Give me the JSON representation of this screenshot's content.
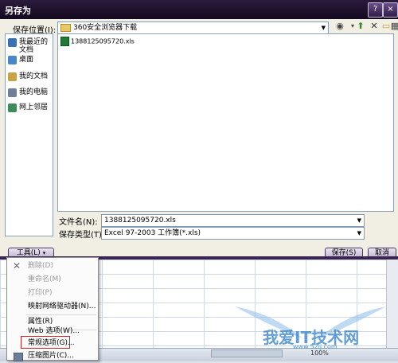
{
  "title": "另存为",
  "window_controls": {
    "help": "?",
    "close": "×"
  },
  "save_in": {
    "label": "保存位置(I):",
    "value": "360安全浏览器下载"
  },
  "places": [
    {
      "label": "我最近的文档",
      "icon": "recent-docs-icon",
      "color": "#3a6fb0"
    },
    {
      "label": "桌面",
      "icon": "desktop-icon",
      "color": "#4a86c7"
    },
    {
      "label": "我的文档",
      "icon": "my-documents-icon",
      "color": "#c8a24a"
    },
    {
      "label": "我的电脑",
      "icon": "my-computer-icon",
      "color": "#6f7f9a"
    },
    {
      "label": "网上邻居",
      "icon": "network-places-icon",
      "color": "#3f8a5a"
    }
  ],
  "files": [
    {
      "name": "1388125095720.xls",
      "icon": "excel-file-icon"
    }
  ],
  "filename": {
    "label": "文件名(N):",
    "value": "1388125095720.xls"
  },
  "filetype": {
    "label": "保存类型(T):",
    "value": "Excel 97-2003 工作簿(*.xls)"
  },
  "buttons": {
    "tools": "工具(L)",
    "save": "保存(S)",
    "cancel": "取消"
  },
  "tools_menu": [
    {
      "label": "删除(D)",
      "disabled": true,
      "icon": "delete-icon"
    },
    {
      "label": "重命名(M)",
      "disabled": true,
      "icon": ""
    },
    {
      "label": "打印(P)",
      "disabled": true,
      "icon": ""
    },
    {
      "label": "映射网络驱动器(N)...",
      "disabled": false,
      "icon": ""
    },
    {
      "label": "属性(R)",
      "disabled": false,
      "icon": ""
    },
    {
      "label": "Web 选项(W)...",
      "disabled": false,
      "icon": ""
    },
    {
      "label": "常规选项(G)...",
      "disabled": false,
      "icon": ""
    },
    {
      "label": "压缩图片(C)...",
      "disabled": false,
      "icon": "compress-pictures-icon"
    }
  ],
  "status": {
    "zoom": "100%"
  },
  "watermark": {
    "text": "我爱IT技术网",
    "url": "www.52ij.com"
  }
}
